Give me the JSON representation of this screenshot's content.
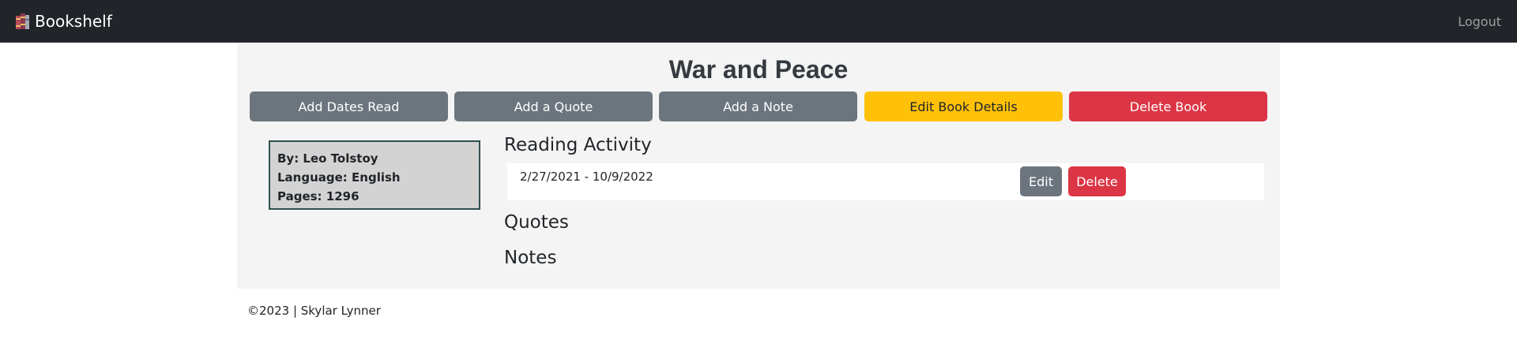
{
  "navbar": {
    "brand_icon": "books-icon",
    "brand_label": "Bookshelf",
    "logout_label": "Logout"
  },
  "book": {
    "title": "War and Peace",
    "author_line": "By: Leo Tolstoy",
    "language_line": "Language: English",
    "pages_line": "Pages: 1296"
  },
  "actions": {
    "add_dates_label": "Add Dates Read",
    "add_quote_label": "Add a Quote",
    "add_note_label": "Add a Note",
    "edit_book_label": "Edit Book Details",
    "delete_book_label": "Delete Book"
  },
  "reading_activity": {
    "heading": "Reading Activity",
    "entries": [
      {
        "dates": "2/27/2021 - 10/9/2022",
        "edit_label": "Edit",
        "delete_label": "Delete"
      }
    ]
  },
  "quotes": {
    "heading": "Quotes"
  },
  "notes": {
    "heading": "Notes"
  },
  "footer": {
    "text": "©2023 | Skylar Lynner"
  },
  "colors": {
    "navbar_bg": "#212529",
    "secondary": "#6c757d",
    "warning": "#ffc107",
    "danger": "#dc3545",
    "info_box_bg": "#d3d3d3",
    "info_box_border": "#2f4f4f",
    "container_bg": "#f4f4f4"
  }
}
